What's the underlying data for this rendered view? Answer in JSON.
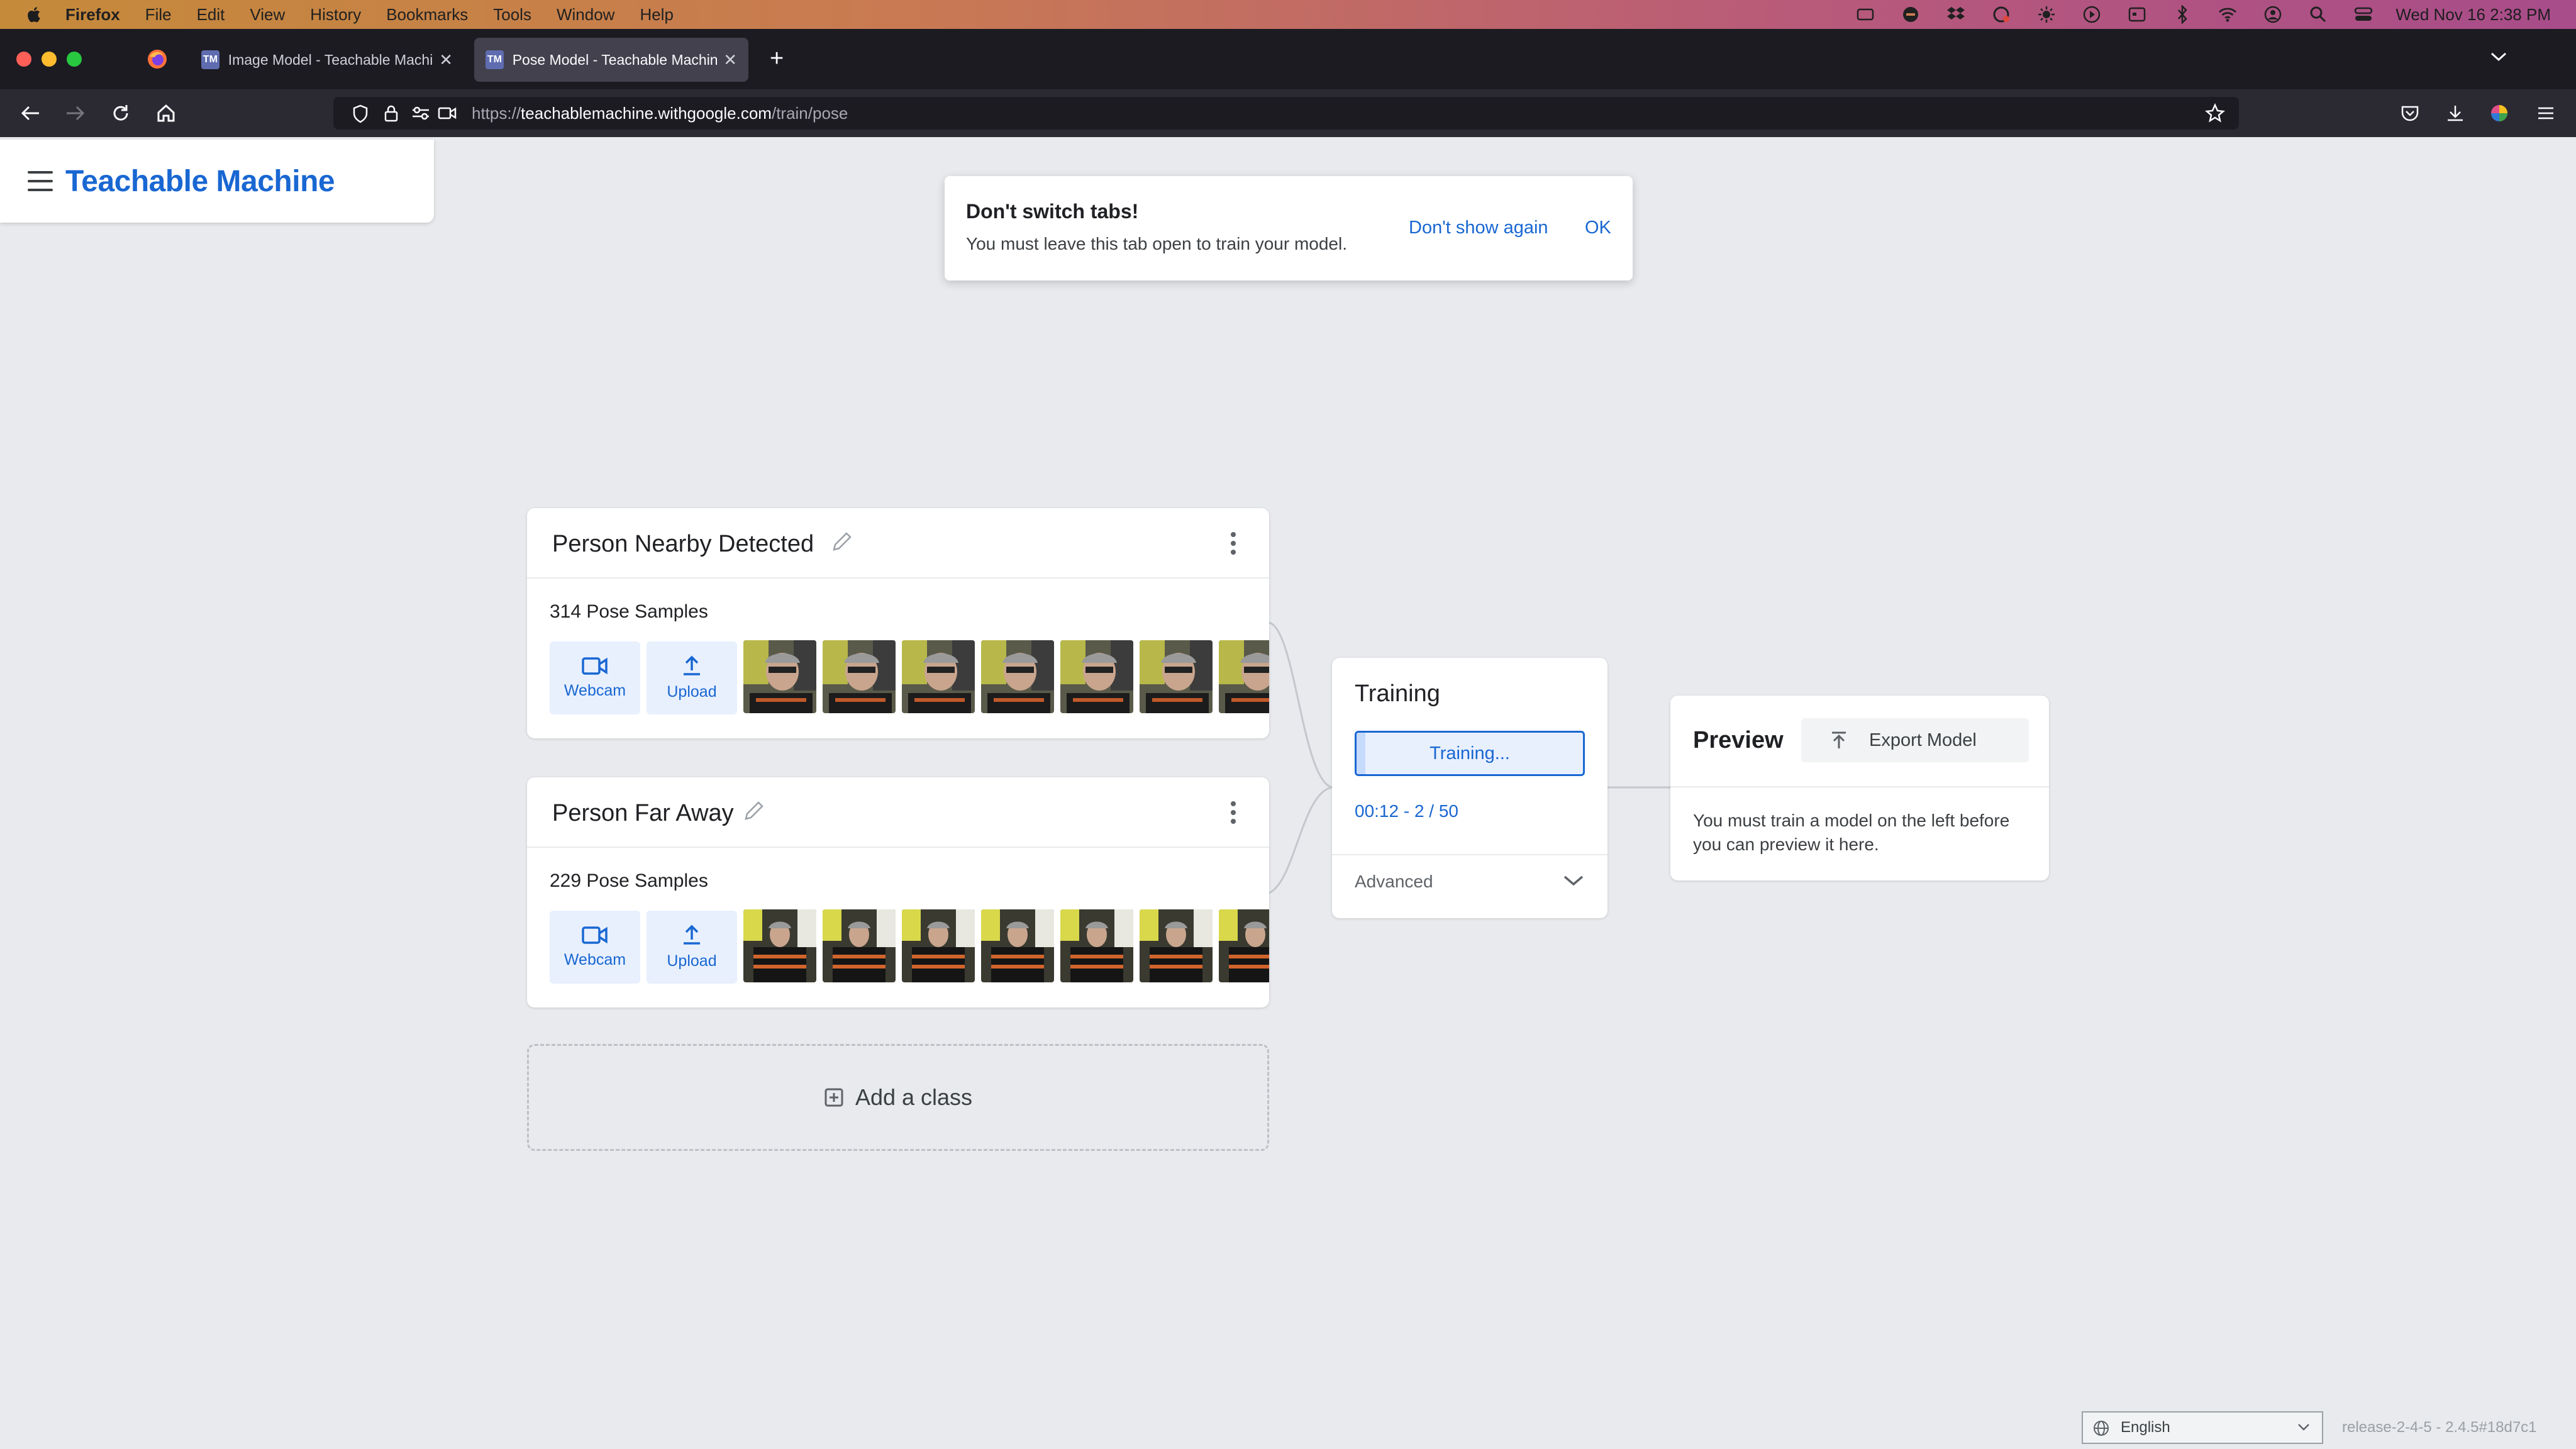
{
  "menubar": {
    "app": "Firefox",
    "items": [
      "File",
      "Edit",
      "View",
      "History",
      "Bookmarks",
      "Tools",
      "Window",
      "Help"
    ],
    "clock": "Wed Nov 16  2:38 PM"
  },
  "tabs": [
    {
      "icon": "TM",
      "title": "Image Model - Teachable Machin",
      "active": false
    },
    {
      "icon": "TM",
      "title": "Pose Model - Teachable Machin",
      "active": true
    }
  ],
  "url": {
    "protocol": "https://",
    "host": "teachablemachine.withgoogle.com",
    "path": "/train/pose"
  },
  "brand": {
    "title": "Teachable Machine"
  },
  "toast": {
    "title": "Don't switch tabs!",
    "message": "You must leave this tab open to train your model.",
    "dont_show": "Don't show again",
    "ok": "OK"
  },
  "classes": [
    {
      "name": "Person Nearby Detected",
      "samples": "314 Pose Samples",
      "webcam": "Webcam",
      "upload": "Upload"
    },
    {
      "name": "Person Far Away",
      "samples": "229 Pose Samples",
      "webcam": "Webcam",
      "upload": "Upload"
    }
  ],
  "add_class": "Add a class",
  "training": {
    "title": "Training",
    "button": "Training...",
    "progress_text": "00:12 - 2 / 50",
    "progress_fraction": 0.04,
    "advanced": "Advanced"
  },
  "preview": {
    "title": "Preview",
    "export": "Export Model",
    "message": "You must train a model on the left before you can preview it here."
  },
  "footer": {
    "language": "English",
    "release": "release-2-4-5 - 2.4.5#18d7c1"
  },
  "colors": {
    "accent": "#1967d2",
    "accent_bg": "#e8f0fe",
    "page_bg": "#e8eaed"
  }
}
